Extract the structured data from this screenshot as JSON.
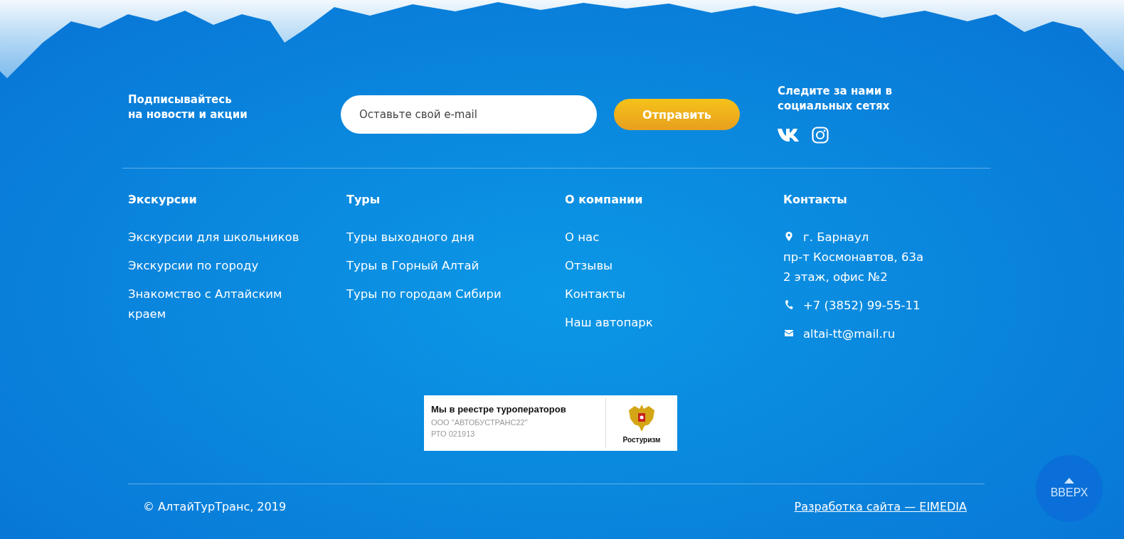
{
  "subscribe": {
    "title": "Подписывайтесь\nна новости и акции",
    "placeholder": "Оставьте свой e-mail",
    "button": "Отправить"
  },
  "social": {
    "title": "Следите за нами в\nсоциальных сетях"
  },
  "columns": [
    {
      "title": "Экскурсии",
      "links": [
        "Экскурсии для школьников",
        "Экскурсии по городу",
        "Знакомство с Алтайским краем"
      ]
    },
    {
      "title": "Туры",
      "links": [
        "Туры выходного дня",
        "Туры в Горный Алтай",
        "Туры по городам Сибири"
      ]
    },
    {
      "title": "О компании",
      "links": [
        "О нас",
        "Отзывы",
        "Контакты",
        "Наш автопарк"
      ]
    }
  ],
  "contacts": {
    "title": "Контакты",
    "items": [
      {
        "kind": "address",
        "text": "г. Барнаул",
        "more": [
          "пр-т Космонавтов, 63а",
          "2 этаж, офис №2"
        ]
      },
      {
        "kind": "phone",
        "text": "+7 (3852) 99-55-11"
      },
      {
        "kind": "email",
        "text": "altai-tt@mail.ru"
      }
    ]
  },
  "registry": {
    "title": "Мы в реестре туроператоров",
    "company": "ООО \"АВТОБУСТРАНС22\"",
    "number": "РТО 021913",
    "agency": "Ростуризм"
  },
  "footer": {
    "copyright": "© АлтайТурТранс, 2019",
    "developer": "Разработка сайта — EIMEDIA"
  },
  "to_top": "ВВЕРХ"
}
